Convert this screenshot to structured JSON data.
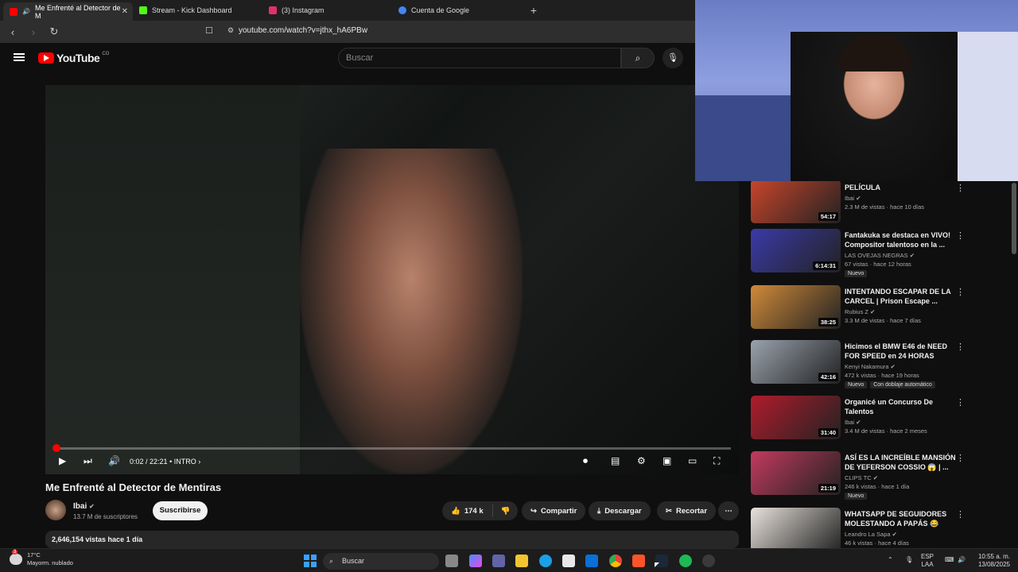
{
  "browser": {
    "tabs": [
      {
        "label": "Me Enfrenté al Detector de M",
        "active": true,
        "color": "#ff0000"
      },
      {
        "label": "Stream - Kick Dashboard",
        "active": false,
        "color": "#53fc18"
      },
      {
        "label": "(3) Instagram",
        "active": false,
        "color": "#e1306c"
      },
      {
        "label": "Cuenta de Google",
        "active": false,
        "color": "#4285f4"
      }
    ],
    "url": "youtube.com/watch?v=jthx_hA6PBw"
  },
  "youtube": {
    "logo_text": "YouTube",
    "logo_region": "CO",
    "search_placeholder": "Buscar"
  },
  "player": {
    "time": "0:02 / 22:21",
    "chapter": "• INTRO",
    "progress_fraction": 0.0015
  },
  "video": {
    "title": "Me Enfrenté al Detector de Mentiras",
    "channel": "Ibai",
    "subscribers": "13.7 M de suscriptores",
    "subscribe_label": "Suscribirse",
    "likes": "174 k",
    "share_label": "Compartir",
    "download_label": "Descargar",
    "clip_label": "Recortar",
    "views_date": "2,646,154 vistas  hace 1 día"
  },
  "related": [
    {
      "title": "PELÍCULA",
      "channel": "Ibai",
      "meta": "2.3 M de vistas · hace 10 días",
      "duration": "54:17",
      "badges": [],
      "thumb": "#c9452b"
    },
    {
      "title": "Fantakuka se destaca en VIVO! Compositor talentoso en la ...",
      "channel": "LAS OVEJAS NEGRAS",
      "meta": "67 vistas · hace 12 horas",
      "duration": "6:14:31",
      "badges": [
        "Nuevo"
      ],
      "thumb": "#3a3aa8"
    },
    {
      "title": "INTENTANDO ESCAPAR DE LA CARCEL | Prison Escape ...",
      "channel": "Rubius Z",
      "meta": "3.3 M de vistas · hace 7 días",
      "duration": "38:25",
      "badges": [],
      "thumb": "#d08a3a"
    },
    {
      "title": "Hicimos el BMW E46 de NEED FOR SPEED en 24 HORAS",
      "channel": "Kenyi Nakamura",
      "meta": "472 k vistas · hace 19 horas",
      "duration": "42:16",
      "badges": [
        "Nuevo",
        "Con doblaje automático"
      ],
      "thumb": "#9aa2ad"
    },
    {
      "title": "Organicé un Concurso De Talentos",
      "channel": "Ibai",
      "meta": "3.4 M de vistas · hace 2 meses",
      "duration": "31:40",
      "badges": [],
      "thumb": "#b01c2c"
    },
    {
      "title": "ASÍ ES LA INCREÍBLE MANSIÓN DE YEFERSON COSSIO 😱 | ...",
      "channel": "CLIPS TC",
      "meta": "246 k vistas · hace 1 día",
      "duration": "21:19",
      "badges": [
        "Nuevo"
      ],
      "thumb": "#c23a5e"
    },
    {
      "title": "WHATSAPP DE SEGUIDORES MOLESTANDO A PAPÁS 😂",
      "channel": "Leandro La Sapa",
      "meta": "46 k vistas · hace 4 días",
      "duration": "",
      "badges": [],
      "thumb": "#e8e2dc"
    }
  ],
  "taskbar": {
    "temperature": "17°C",
    "weather": "Mayorm. nublado",
    "weather_badge": "3",
    "search_label": "Buscar",
    "language": "ESP",
    "layout": "LAA",
    "time": "10:55 a. m.",
    "date": "13/08/2025"
  }
}
